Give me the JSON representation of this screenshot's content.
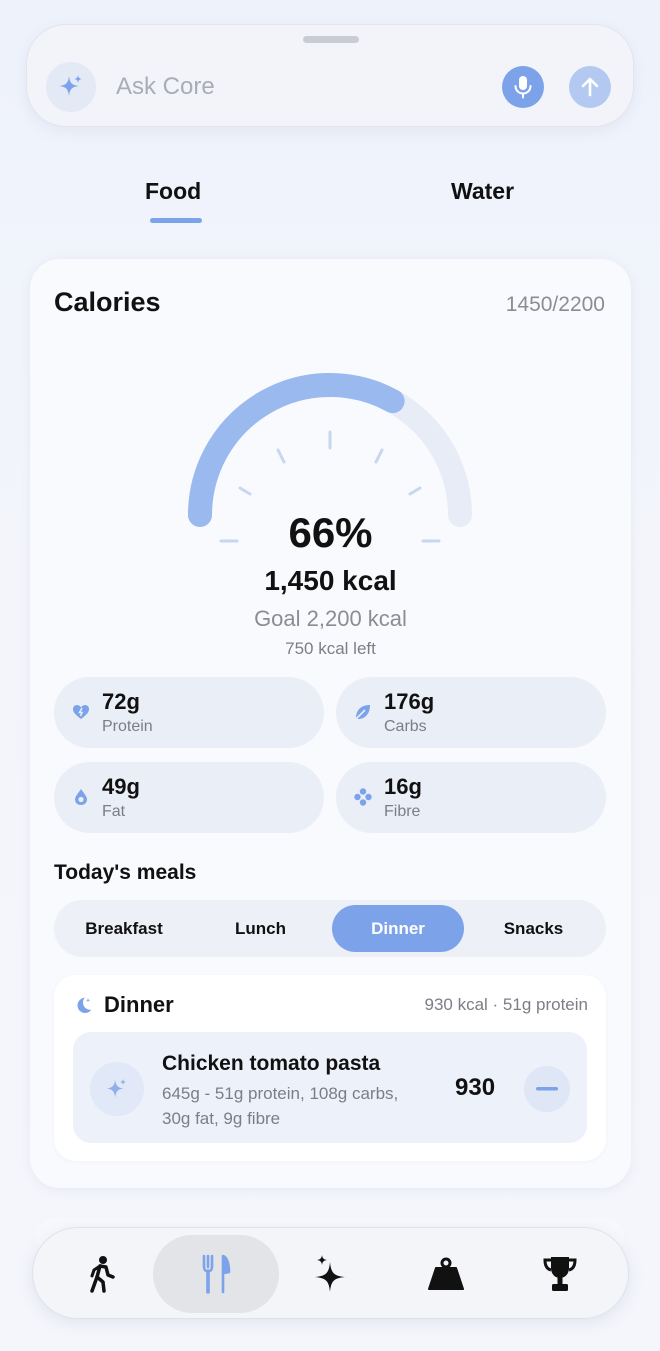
{
  "ask": {
    "placeholder": "Ask Core"
  },
  "tabs": [
    {
      "label": "Food",
      "active": true
    },
    {
      "label": "Water",
      "active": false
    }
  ],
  "calories": {
    "title": "Calories",
    "count": "1450/2200",
    "percent": "66%",
    "progress_fraction": 0.66,
    "kcal": "1,450 kcal",
    "goal": "Goal 2,200 kcal",
    "left": "750 kcal left"
  },
  "macros": [
    {
      "value": "72g",
      "label": "Protein",
      "icon": "heart-icon"
    },
    {
      "value": "176g",
      "label": "Carbs",
      "icon": "leaf-icon"
    },
    {
      "value": "49g",
      "label": "Fat",
      "icon": "drop-icon"
    },
    {
      "value": "16g",
      "label": "Fibre",
      "icon": "flower-icon"
    }
  ],
  "meals": {
    "title": "Today's meals",
    "segments": [
      "Breakfast",
      "Lunch",
      "Dinner",
      "Snacks"
    ],
    "selected": "Dinner",
    "section": {
      "title": "Dinner",
      "summary": "930 kcal · 51g protein",
      "items": [
        {
          "name": "Chicken tomato pasta",
          "detail": "645g - 51g protein, 108g carbs, 30g fat, 9g fibre",
          "kcal": "930"
        }
      ]
    }
  },
  "nav": [
    {
      "icon": "walking-icon",
      "active": false
    },
    {
      "icon": "fork-knife-icon",
      "active": true
    },
    {
      "icon": "sparkle-icon",
      "active": false
    },
    {
      "icon": "weight-icon",
      "active": false
    },
    {
      "icon": "trophy-icon",
      "active": false
    }
  ],
  "colors": {
    "accent": "#7ca3ea",
    "accent_light": "#b3c9f1",
    "muted_text": "#8a8d94"
  }
}
